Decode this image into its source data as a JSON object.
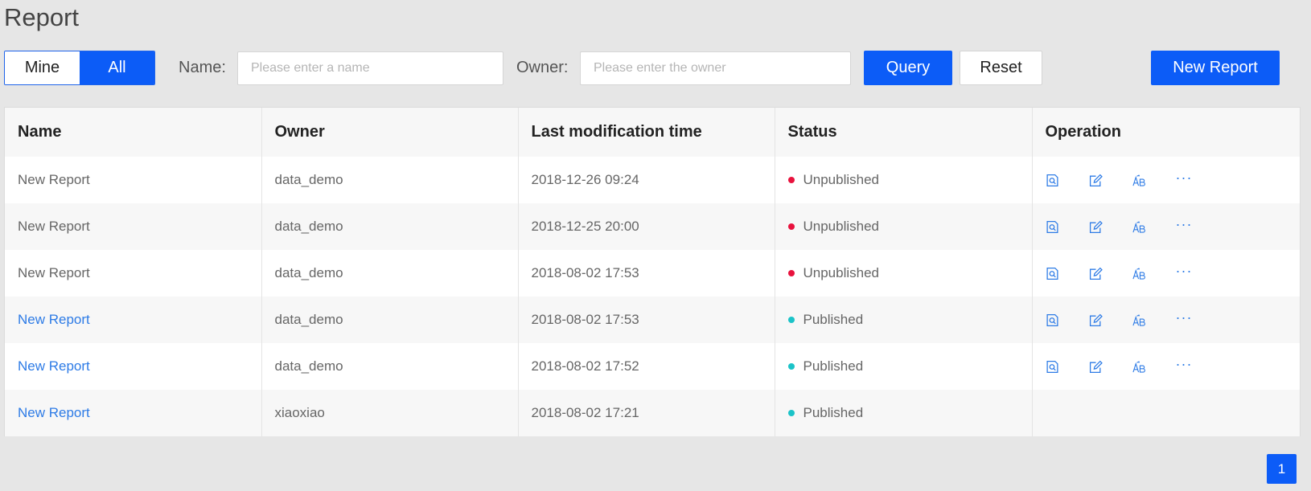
{
  "page": {
    "title": "Report"
  },
  "toolbar": {
    "seg_mine": "Mine",
    "seg_all": "All",
    "name_label": "Name:",
    "name_placeholder": "Please enter a name",
    "owner_label": "Owner:",
    "owner_placeholder": "Please enter the owner",
    "query_label": "Query",
    "reset_label": "Reset",
    "new_report_label": "New Report"
  },
  "table": {
    "headers": [
      "Name",
      "Owner",
      "Last modification time",
      "Status",
      "Operation"
    ],
    "rows": [
      {
        "name": "New Report",
        "owner": "data_demo",
        "modified": "2018-12-26 09:24",
        "status": "Unpublished"
      },
      {
        "name": "New Report",
        "owner": "data_demo",
        "modified": "2018-12-25 20:00",
        "status": "Unpublished"
      },
      {
        "name": "New Report",
        "owner": "data_demo",
        "modified": "2018-08-02 17:53",
        "status": "Unpublished"
      },
      {
        "name": "New Report",
        "owner": "data_demo",
        "modified": "2018-08-02 17:53",
        "status": "Published"
      },
      {
        "name": "New Report",
        "owner": "data_demo",
        "modified": "2018-08-02 17:52",
        "status": "Published"
      },
      {
        "name": "New Report",
        "owner": "xiaoxiao",
        "modified": "2018-08-02 17:21",
        "status": "Published"
      }
    ],
    "operation_icons": [
      "preview-icon",
      "edit-icon",
      "rename-icon",
      "more-icon"
    ],
    "more_glyph": "···"
  },
  "pagination": {
    "current_page": "1"
  },
  "colors": {
    "accent": "#0c5cf7",
    "link": "#2d7be6",
    "unpublished": "#e8123d",
    "published": "#1bc3c8"
  }
}
